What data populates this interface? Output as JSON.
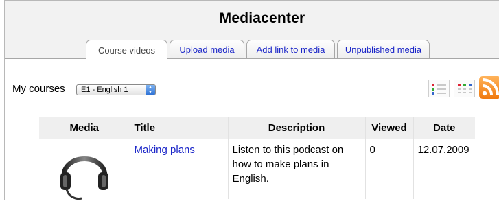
{
  "page": {
    "title": "Mediacenter"
  },
  "tabs": [
    {
      "label": "Course videos",
      "active": true
    },
    {
      "label": "Upload media",
      "active": false
    },
    {
      "label": "Add link to media",
      "active": false
    },
    {
      "label": "Unpublished media",
      "active": false
    }
  ],
  "filter": {
    "label": "My courses",
    "selected": "E1 - English 1"
  },
  "view_icons": [
    "list-view-icon",
    "grid-view-icon",
    "rss-feed-icon"
  ],
  "colors": {
    "link": "#1a25c8",
    "rss": "#f07a0f",
    "header_bg": "#f2f2f2"
  },
  "table": {
    "headers": {
      "media": "Media",
      "title": "Title",
      "description": "Description",
      "viewed": "Viewed",
      "date": "Date"
    },
    "rows": [
      {
        "media_icon": "headset-icon",
        "title": "Making plans",
        "description": "Listen to this podcast on how to make plans in English.",
        "viewed": "0",
        "date": "12.07.2009"
      }
    ]
  }
}
